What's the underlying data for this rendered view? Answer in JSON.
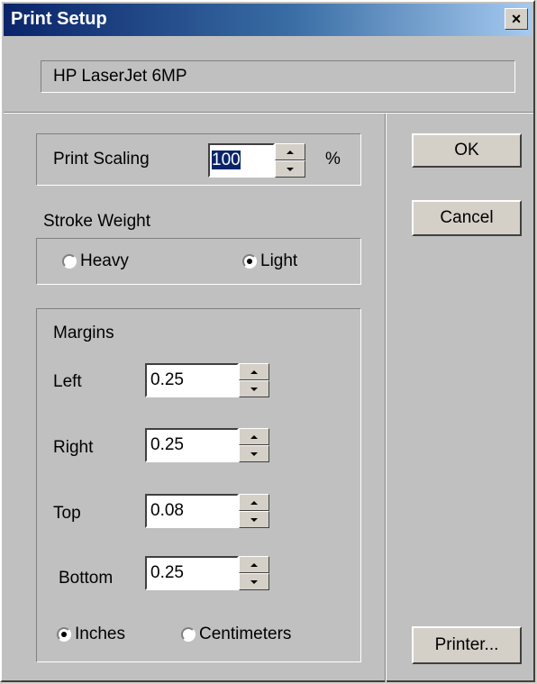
{
  "window": {
    "title": "Print Setup",
    "close_glyph": "×"
  },
  "printer": {
    "name": "HP LaserJet 6MP"
  },
  "scaling": {
    "label": "Print Scaling",
    "value": "100",
    "unit": "%"
  },
  "stroke": {
    "label": "Stroke Weight",
    "options": [
      {
        "label": "Heavy",
        "checked": false
      },
      {
        "label": "Light",
        "checked": true
      }
    ]
  },
  "margins": {
    "label": "Margins",
    "left": {
      "label": "Left",
      "value": "0.25"
    },
    "right": {
      "label": "Right",
      "value": "0.25"
    },
    "top": {
      "label": "Top",
      "value": "0.08"
    },
    "bottom": {
      "label": "Bottom",
      "value": "0.25"
    },
    "units": [
      {
        "label": "Inches",
        "checked": true
      },
      {
        "label": "Centimeters",
        "checked": false
      }
    ]
  },
  "buttons": {
    "ok": "OK",
    "cancel": "Cancel",
    "printer": "Printer..."
  },
  "icons": {
    "close": "close-icon",
    "spin_up": "arrow-up-icon",
    "spin_down": "arrow-down-icon",
    "radio": "radio-icon"
  }
}
